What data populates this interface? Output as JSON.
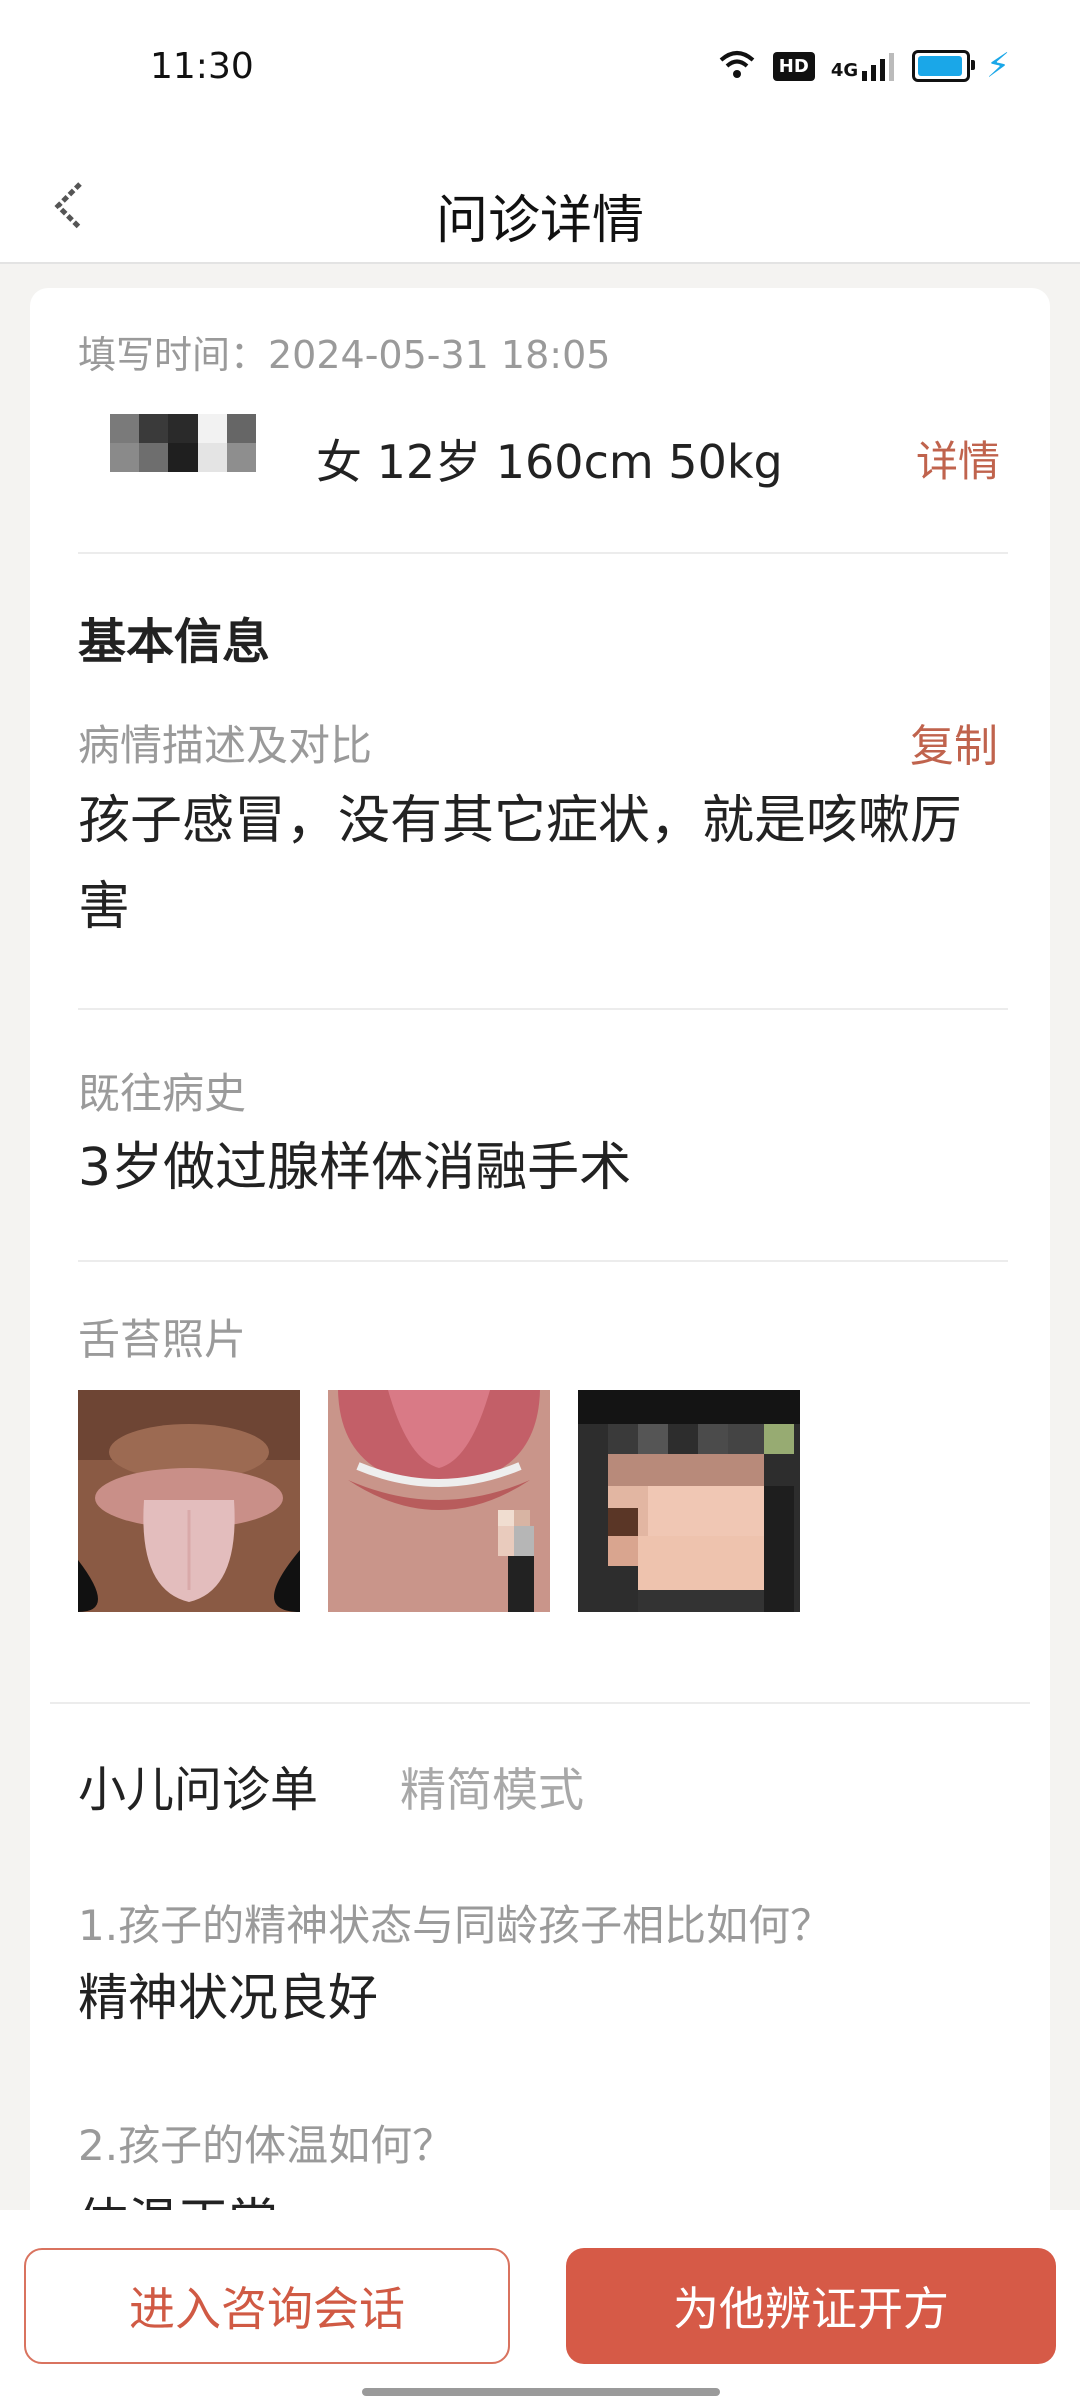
{
  "status_bar": {
    "time": "11:30",
    "hd_label": "HD",
    "network_label": "4G",
    "battery_level": 0.95,
    "icons": [
      "wifi-icon",
      "hd-icon",
      "signal-icon",
      "battery-icon",
      "charging-icon"
    ]
  },
  "nav": {
    "title": "问诊详情",
    "back_icon": "back-arrow-icon"
  },
  "record": {
    "fill_time": "填写时间：2024-05-31 18:05",
    "patient_info": "女 12岁 160cm 50kg",
    "detail_link": "详情"
  },
  "basic_info": {
    "title": "基本信息",
    "description_label": "病情描述及对比",
    "copy_label": "复制",
    "description_line1": "孩子感冒，没有其它症状，就是咳嗽厉",
    "description_line2": "害",
    "history_label": "既往病史",
    "history_text": "3岁做过腺样体消融手术",
    "tongue_label": "舌苔照片"
  },
  "questionnaire": {
    "tab_active": "小儿问诊单",
    "tab_inactive": "精简模式",
    "items": [
      {
        "question": "1.孩子的精神状态与同龄孩子相比如何？",
        "answer": "精神状况良好"
      },
      {
        "question": "2.孩子的体温如何？",
        "answer": "体温正常"
      }
    ]
  },
  "actions": {
    "consult_button": "进入咨询会话",
    "prescribe_button": "为他辨证开方"
  },
  "colors": {
    "accent": "#d65a47",
    "link": "#c0634d",
    "battery": "#1aa7e8"
  }
}
